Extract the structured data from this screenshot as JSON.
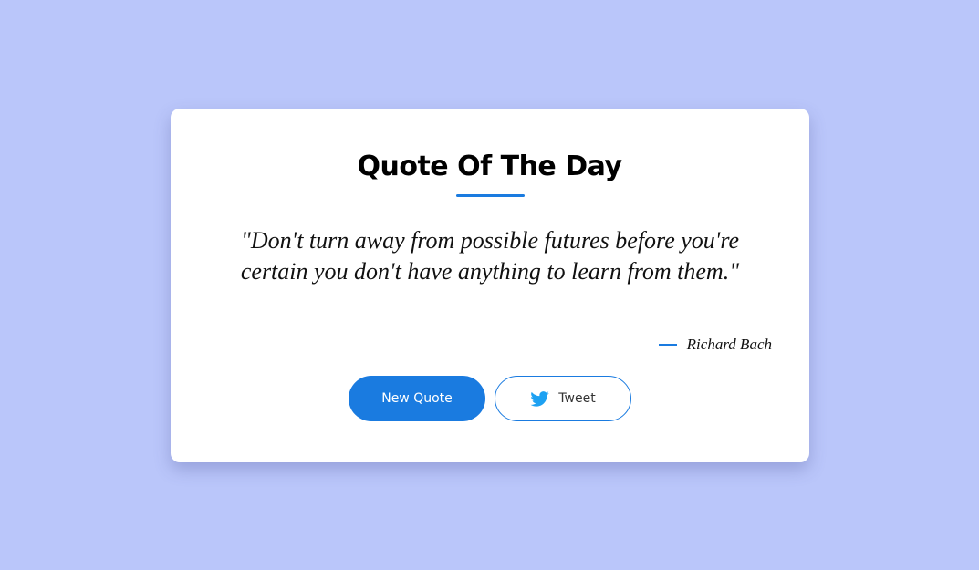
{
  "card": {
    "title": "Quote Of The Day",
    "quote": "\"Don't turn away from possible futures before you're certain you don't have anything to learn from them.\"",
    "author": "Richard Bach"
  },
  "buttons": {
    "new_quote_label": "New Quote",
    "tweet_label": "Tweet",
    "tweet_icon": "twitter-icon"
  },
  "colors": {
    "background": "#bac6fa",
    "accent": "#1a7be0",
    "twitter": "#1da1f2"
  }
}
